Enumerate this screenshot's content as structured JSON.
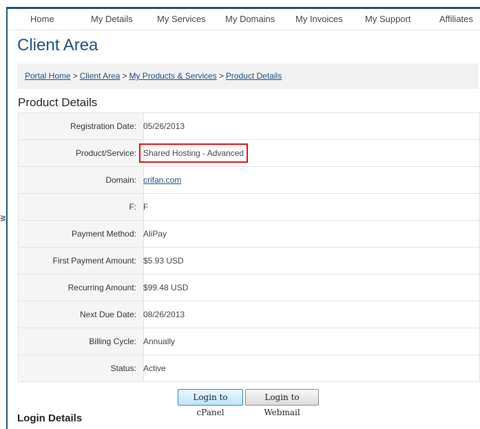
{
  "nav": {
    "items": [
      {
        "label": "Home"
      },
      {
        "label": "My Details"
      },
      {
        "label": "My Services"
      },
      {
        "label": "My Domains"
      },
      {
        "label": "My Invoices"
      },
      {
        "label": "My Support"
      },
      {
        "label": "Affiliates"
      }
    ]
  },
  "page": {
    "title": "Client Area"
  },
  "breadcrumb": {
    "items": [
      "Portal Home",
      "Client Area",
      "My Products & Services",
      "Product Details"
    ],
    "separator": ">"
  },
  "product_details": {
    "heading": "Product Details",
    "rows": [
      {
        "label": "Registration Date:",
        "value": "05/26/2013"
      },
      {
        "label": "Product/Service:",
        "value": "Shared Hosting - Advanced",
        "highlighted": true
      },
      {
        "label": "Domain:",
        "value": "crifan.com",
        "link": true
      },
      {
        "label": "F:",
        "value": "F"
      },
      {
        "label": "Payment Method:",
        "value": "AliPay"
      },
      {
        "label": "First Payment Amount:",
        "value": "$5.93 USD"
      },
      {
        "label": "Recurring Amount:",
        "value": "$99.48 USD"
      },
      {
        "label": "Next Due Date:",
        "value": "08/26/2013"
      },
      {
        "label": "Billing Cycle:",
        "value": "Annually"
      },
      {
        "label": "Status:",
        "value": "Active"
      }
    ]
  },
  "actions": {
    "cpanel_label": "Login to cPanel",
    "webmail_label": "Login to Webmail"
  },
  "login_details": {
    "heading": "Login Details"
  },
  "side_glyph": "ᕒ",
  "colors": {
    "accent": "#1d4f80",
    "highlight": "#e01010",
    "label_bg": "#f5f5f5",
    "breadcrumb_bg": "#f2f2f2"
  }
}
